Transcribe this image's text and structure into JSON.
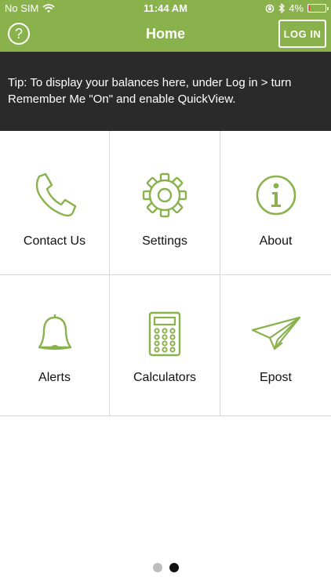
{
  "status_bar": {
    "carrier": "No SIM",
    "time": "11:44 AM",
    "battery": "4%",
    "battery_level": 0.04
  },
  "nav": {
    "title": "Home",
    "help_symbol": "?",
    "login_label": "LOG IN"
  },
  "tip": {
    "text": "Tip: To display your balances here, under Log in > turn Remember Me \"On\" and enable QuickView."
  },
  "menu": [
    {
      "label": "Contact Us",
      "icon": "phone-icon"
    },
    {
      "label": "Settings",
      "icon": "gear-icon"
    },
    {
      "label": "About",
      "icon": "info-icon"
    },
    {
      "label": "Alerts",
      "icon": "bell-icon"
    },
    {
      "label": "Calculators",
      "icon": "calculator-icon"
    },
    {
      "label": "Epost",
      "icon": "paper-plane-icon"
    }
  ],
  "pagination": {
    "pages": 2,
    "current": 2
  },
  "colors": {
    "accent": "#8ab24c",
    "tip_background": "#2a2a2a",
    "battery_low": "#e03c2e"
  }
}
